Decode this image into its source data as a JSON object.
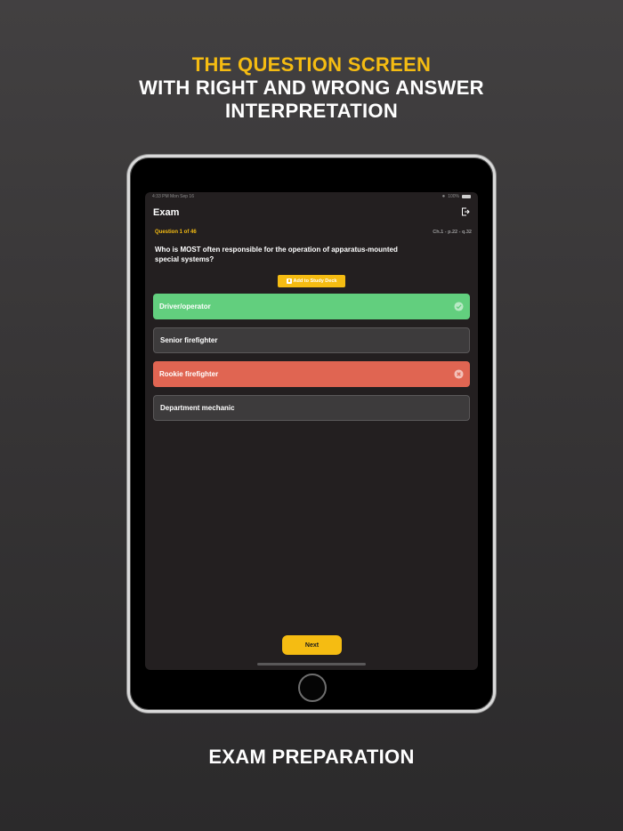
{
  "header": {
    "line1": "THE QUESTION SCREEN",
    "line2": "WITH RIGHT AND WRONG ANSWER",
    "line3": "INTERPRETATION"
  },
  "footer": {
    "caption": "EXAM PREPARATION"
  },
  "status_bar": {
    "time": "4:33 PM  Mon Sep 16",
    "battery": "100%"
  },
  "screen": {
    "title": "Exam",
    "question_count": "Question 1 of 46",
    "reference": "Ch.1 - p.22 - q.32",
    "question": "Who is MOST often responsible for the operation of apparatus-mounted special systems?",
    "study_button": "Add to Study Deck",
    "answers": [
      {
        "label": "Driver/operator",
        "state": "correct"
      },
      {
        "label": "Senior firefighter",
        "state": "neutral"
      },
      {
        "label": "Rookie firefighter",
        "state": "wrong"
      },
      {
        "label": "Department mechanic",
        "state": "neutral"
      }
    ],
    "next_button": "Next"
  },
  "colors": {
    "accent": "#f5bc12",
    "correct": "#62cf7e",
    "wrong": "#e06552",
    "screen_bg": "#231f20"
  }
}
